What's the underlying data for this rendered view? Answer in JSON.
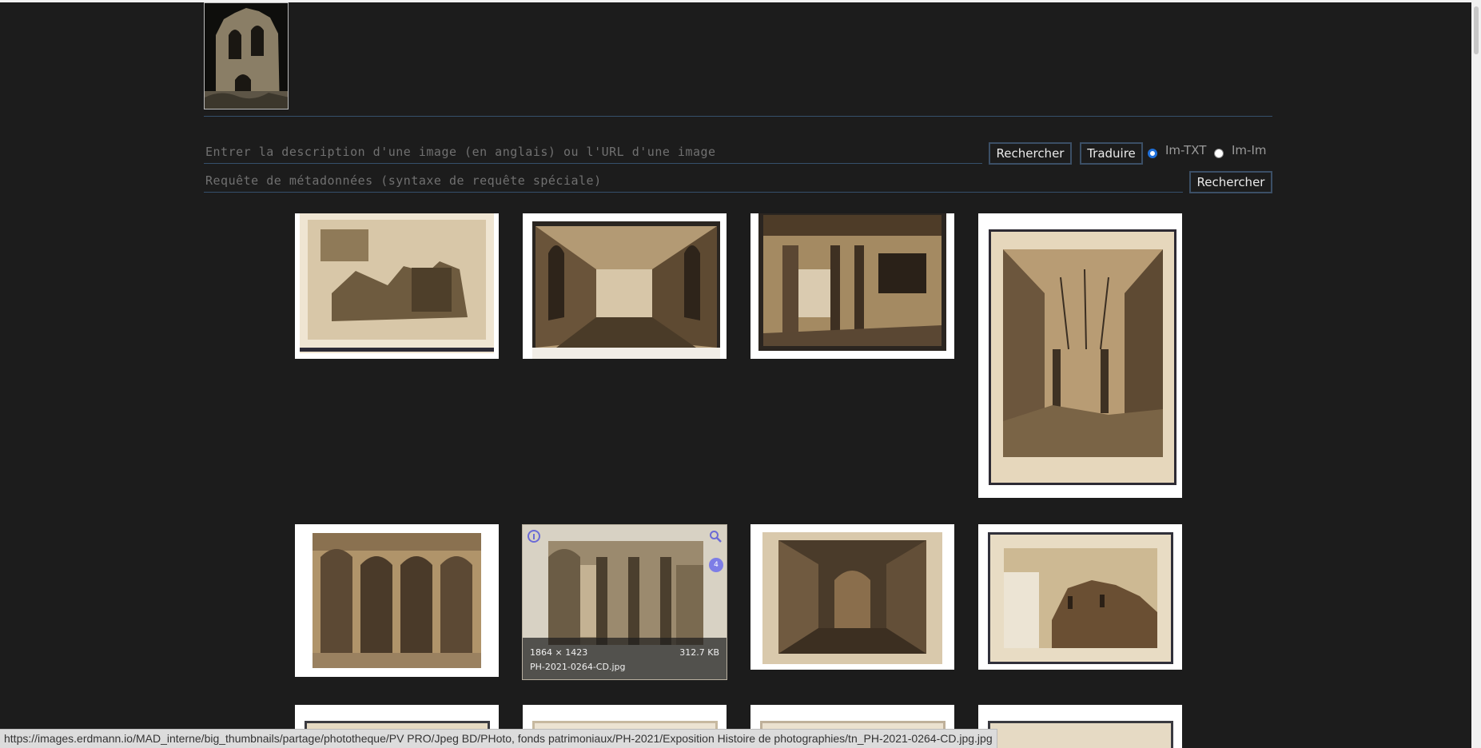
{
  "search": {
    "text_placeholder": "Entrer la description d'une image (en anglais) ou l'URL d'une image",
    "search_button": "Rechercher",
    "translate_button": "Traduire",
    "mode_im_txt": "Im-TXT",
    "mode_im_im": "Im-Im",
    "selected_mode": "Im-TXT",
    "metadata_placeholder": "Requête de métadonnées (syntaxe de requête spéciale)",
    "metadata_search_button": "Rechercher"
  },
  "hover_card": {
    "dimensions": "1864 × 1423",
    "file_size": "312.7 KB",
    "filename": "PH-2021-0264-CD.jpg",
    "badge_count": "4"
  },
  "icons": [
    "info-icon",
    "zoom-icon"
  ],
  "colors": {
    "accent": "#1e6fd9",
    "border": "#35506b",
    "badge": "#7d7de6",
    "background": "#1c1c1c"
  },
  "status_bar": {
    "url": "https://images.erdmann.io/MAD_interne/big_thumbnails/partage/phototheque/PV PRO/Jpeg BD/PHoto, fonds patrimoniaux/PH-2021/Exposition Histoire de photographies/tn_PH-2021-0264-CD.jpg.jpg"
  }
}
